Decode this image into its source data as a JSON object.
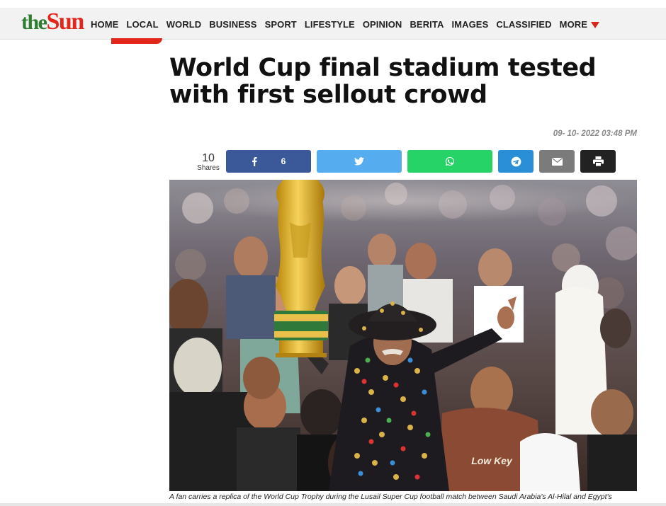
{
  "brand": {
    "logo_the": "the",
    "logo_sun": "Sun"
  },
  "nav": {
    "items": [
      "HOME",
      "LOCAL",
      "WORLD",
      "BUSINESS",
      "SPORT",
      "LIFESTYLE",
      "OPINION",
      "BERITA",
      "IMAGES",
      "CLASSIFIED"
    ],
    "more_label": "MORE"
  },
  "article": {
    "headline": "World Cup final stadium tested with first sellout crowd",
    "date": "09- 10- 2022 03:48 PM",
    "caption": "A fan carries a replica of the World Cup Trophy during the Lusail Super Cup football match between Saudi Arabia's Al-Hilal and Egypt's"
  },
  "share": {
    "count": "10",
    "count_label": "Shares",
    "facebook_count": "6"
  },
  "photo": {
    "sign_text": "Low Key"
  },
  "colors": {
    "facebook": "#3b5998",
    "twitter": "#55acee",
    "whatsapp": "#25d366",
    "telegram": "#2a8fd6",
    "email": "#7b7b7b",
    "print": "#222222",
    "brand_red": "#e3261c",
    "brand_green": "#2e7d32"
  },
  "icons": [
    "facebook-icon",
    "twitter-icon",
    "whatsapp-icon",
    "telegram-icon",
    "email-icon",
    "print-icon",
    "chevron-down-icon"
  ]
}
